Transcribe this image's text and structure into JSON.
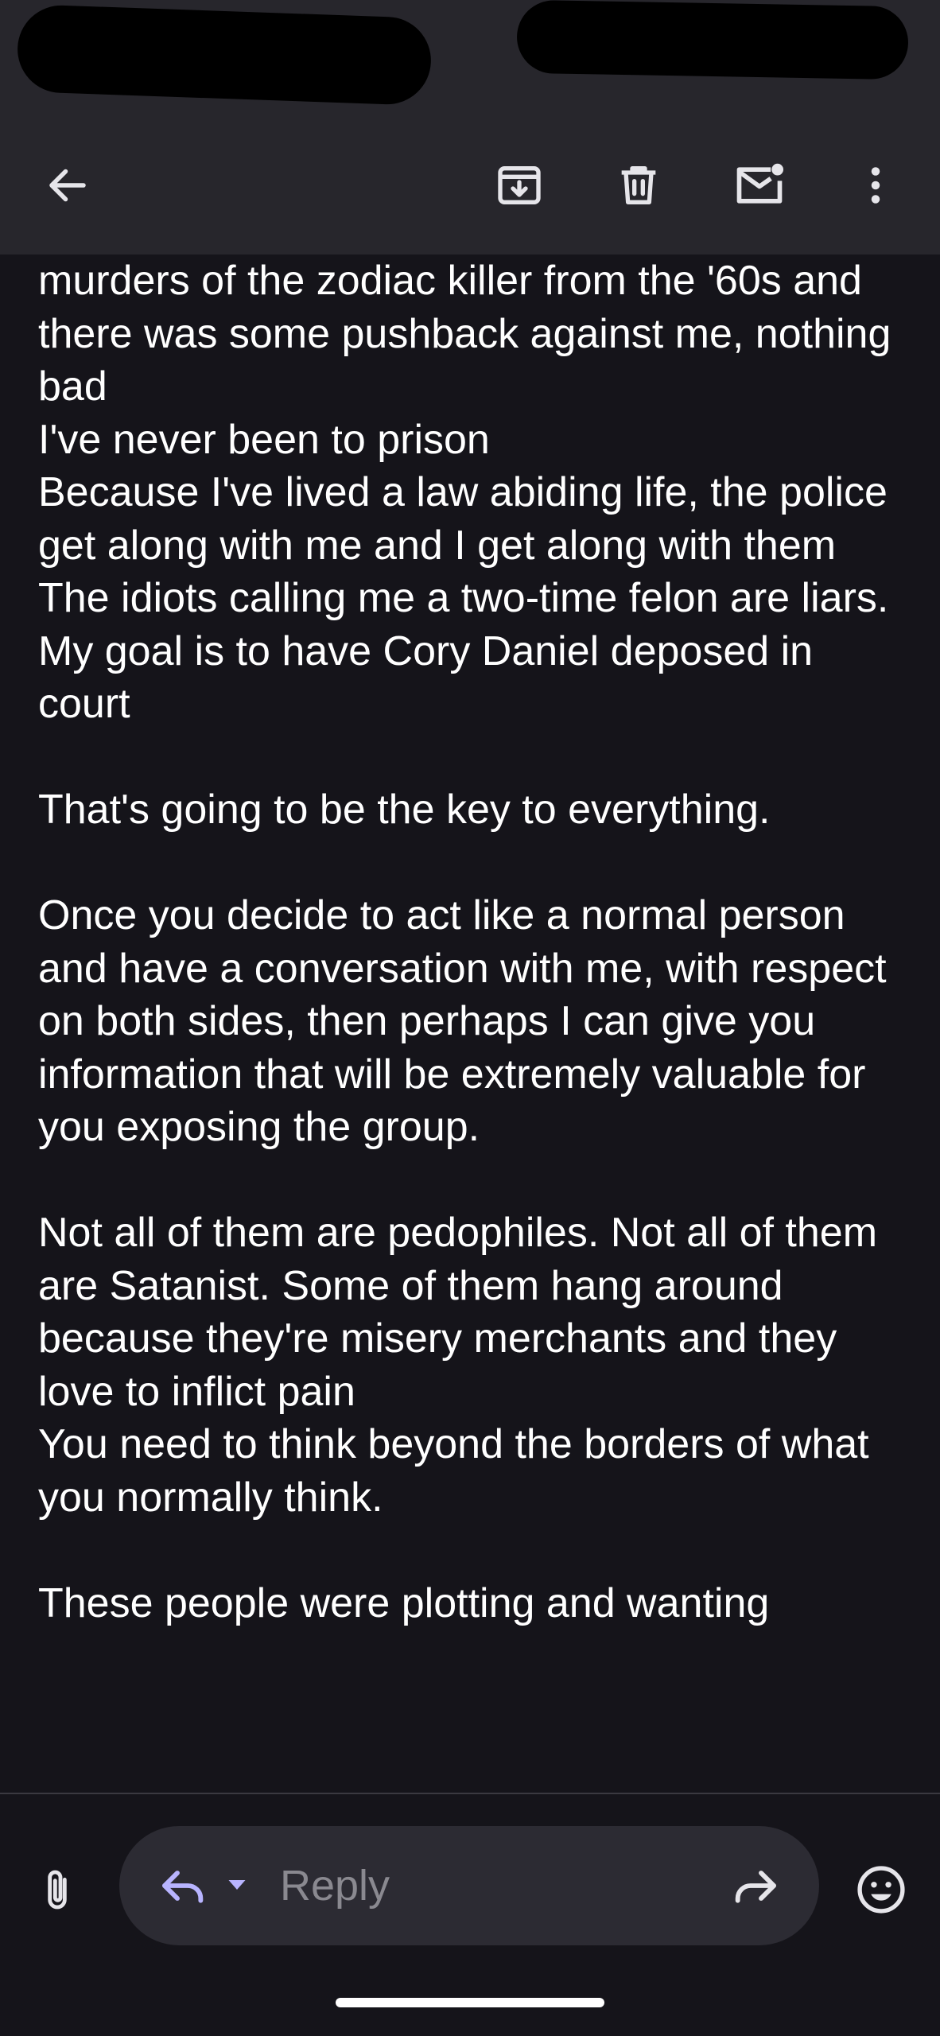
{
  "status_bar": {
    "left_text": "",
    "right_text": ""
  },
  "toolbar": {
    "back": "back-arrow-icon",
    "archive": "archive-icon",
    "delete": "trash-icon",
    "mark_unread": "mark-unread-icon",
    "more": "more-vertical-icon"
  },
  "message": {
    "body": "murders of the zodiac killer from the '60s and there was some pushback against me, nothing bad\nI've never been to prison\nBecause I've lived a law abiding life, the police get along with me and I get along with them\nThe idiots calling me a two-time felon are liars.\nMy goal is to have Cory Daniel deposed in court\n\nThat's going to be the key to everything.\n\nOnce you decide to act like a normal person and have a conversation with me, with respect on both sides, then perhaps I can give you information that will be extremely valuable for you exposing the group.\n\nNot all of them are pedophiles. Not all of them are Satanist. Some of them hang around because they're misery merchants and they love to inflict pain\nYou need to think beyond the borders of what you normally think.\n\nThese people were plotting and wanting"
  },
  "reply_bar": {
    "placeholder": "Reply",
    "attach": "paperclip-icon",
    "reply": "reply-icon",
    "reply_menu": "caret-down-icon",
    "forward": "forward-icon",
    "emoji": "emoji-icon"
  },
  "colors": {
    "background": "#15141a",
    "toolbar": "#27262c",
    "reply_pill": "#2c2b33",
    "reply_accent": "#b8b4ff",
    "icon": "#e6e5ea",
    "placeholder": "#8a8990"
  }
}
